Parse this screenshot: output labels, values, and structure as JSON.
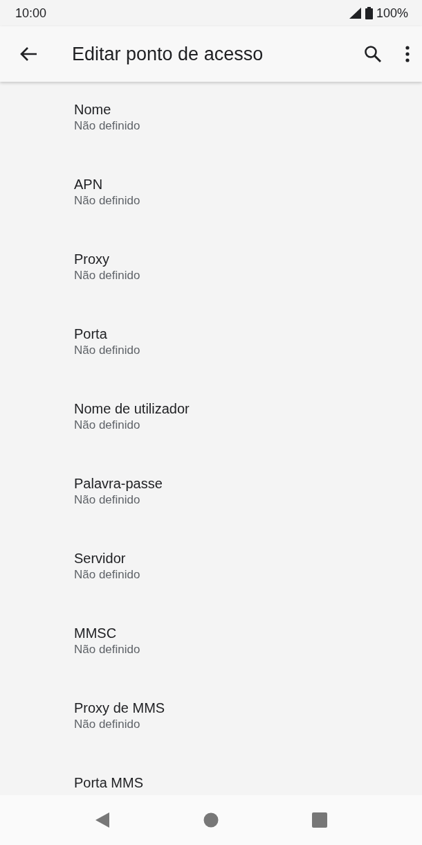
{
  "status_bar": {
    "time": "10:00",
    "battery": "100%"
  },
  "toolbar": {
    "title": "Editar ponto de acesso"
  },
  "items": [
    {
      "title": "Nome",
      "summary": "Não definido"
    },
    {
      "title": "APN",
      "summary": "Não definido"
    },
    {
      "title": "Proxy",
      "summary": "Não definido"
    },
    {
      "title": "Porta",
      "summary": "Não definido"
    },
    {
      "title": "Nome de utilizador",
      "summary": "Não definido"
    },
    {
      "title": "Palavra-passe",
      "summary": "Não definido"
    },
    {
      "title": "Servidor",
      "summary": "Não definido"
    },
    {
      "title": "MMSC",
      "summary": "Não definido"
    },
    {
      "title": "Proxy de MMS",
      "summary": "Não definido"
    },
    {
      "title": "Porta MMS"
    }
  ]
}
